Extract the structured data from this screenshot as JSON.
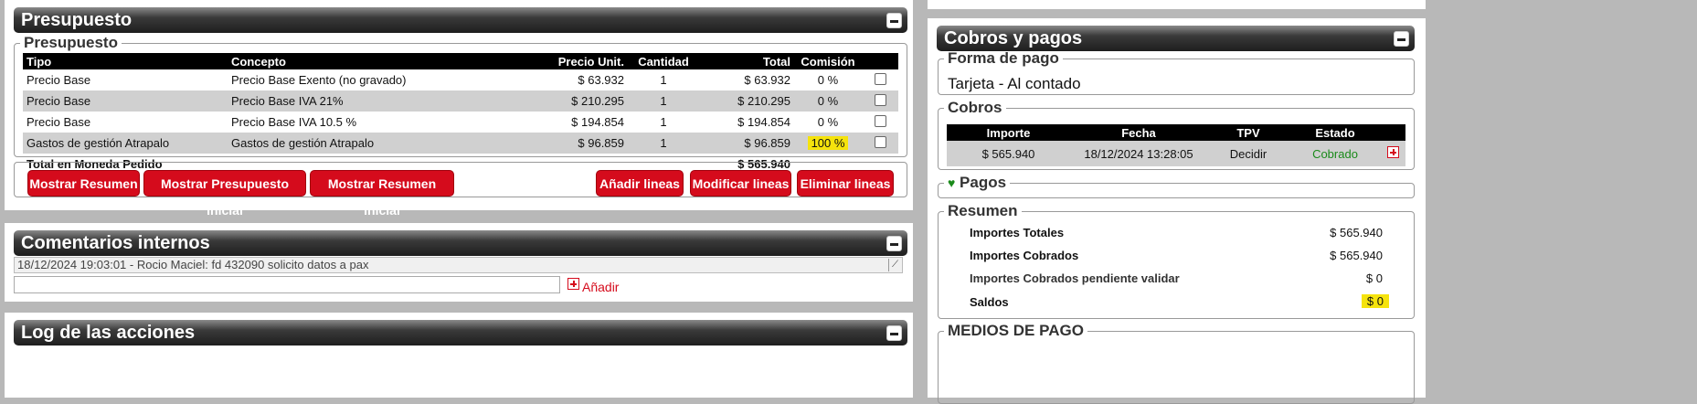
{
  "presupuesto_panel": {
    "title": "Presupuesto",
    "fieldset_legend": "Presupuesto",
    "columns": [
      "Tipo",
      "Concepto",
      "Precio Unit.",
      "Cantidad",
      "Total",
      "Comisión"
    ],
    "rows": [
      {
        "tipo": "Precio Base",
        "concepto": "Precio Base Exento (no gravado)",
        "precio": "$ 63.932",
        "cantidad": "1",
        "total": "$ 63.932",
        "comision": "0 %"
      },
      {
        "tipo": "Precio Base",
        "concepto": "Precio Base IVA 21%",
        "precio": "$ 210.295",
        "cantidad": "1",
        "total": "$ 210.295",
        "comision": "0 %"
      },
      {
        "tipo": "Precio Base",
        "concepto": "Precio Base IVA 10.5 %",
        "precio": "$ 194.854",
        "cantidad": "1",
        "total": "$ 194.854",
        "comision": "0 %"
      },
      {
        "tipo": "Gastos de gestión Atrapalo",
        "concepto": "Gastos de gestión Atrapalo",
        "precio": "$ 96.859",
        "cantidad": "1",
        "total": "$ 96.859",
        "comision": "100 %"
      }
    ],
    "total_label": "Total en Moneda Pedido",
    "total_value": "$ 565.940",
    "buttons": {
      "mostrar_resumen": "Mostrar Resumen",
      "mostrar_presupuesto_inicial": "Mostrar Presupuesto Inicial",
      "mostrar_resumen_inicial": "Mostrar Resumen Inicial",
      "anadir_lineas": "Añadir lineas",
      "modificar_lineas": "Modificar lineas",
      "eliminar_lineas": "Eliminar lineas"
    }
  },
  "comentarios_panel": {
    "title": "Comentarios internos",
    "comment": "18/12/2024 19:03:01 - Rocio Maciel: fd 432090 solicito datos a pax",
    "input_value": "",
    "add_label": "Añadir"
  },
  "log_panel": {
    "title": "Log de las acciones"
  },
  "cobros_panel": {
    "title": "Cobros y pagos",
    "forma_pago_legend": "Forma de pago",
    "forma_pago_value": "Tarjeta - Al contado",
    "cobros_legend": "Cobros",
    "cobros_columns": [
      "Importe",
      "Fecha",
      "TPV",
      "Estado"
    ],
    "cobros_rows": [
      {
        "importe": "$ 565.940",
        "fecha": "18/12/2024 13:28:05",
        "tpv": "Decidir",
        "estado": "Cobrado"
      }
    ],
    "pagos_legend": "Pagos",
    "resumen_legend": "Resumen",
    "resumen_rows": [
      {
        "label": "Importes Totales",
        "value": "$ 565.940"
      },
      {
        "label": "Importes Cobrados",
        "value": "$ 565.940"
      },
      {
        "label": "Importes Cobrados pendiente validar",
        "value": "$ 0"
      },
      {
        "label": "Saldos",
        "value": "$ 0"
      }
    ],
    "medios_legend": "MEDIOS DE PAGO"
  },
  "colors": {
    "accent_red": "#d50b1c",
    "status_green": "#1a8a1a",
    "highlight_yellow": "#f5e30d"
  }
}
